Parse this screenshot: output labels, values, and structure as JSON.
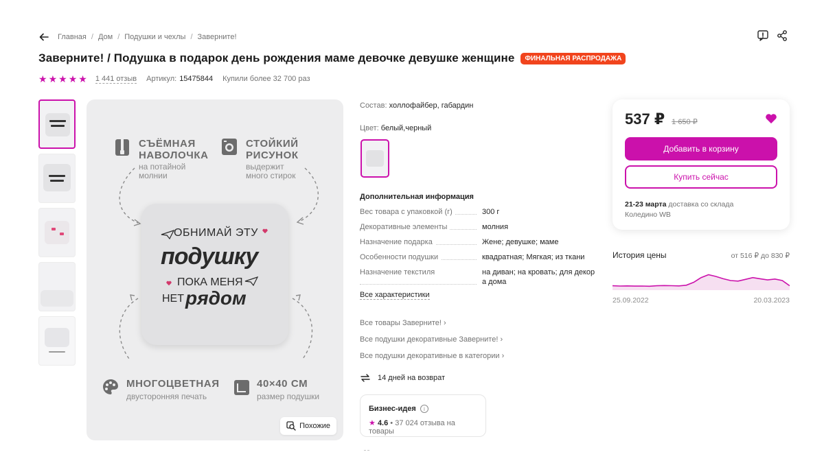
{
  "breadcrumbs": [
    "Главная",
    "Дом",
    "Подушки и чехлы",
    "Заверните!"
  ],
  "product": {
    "title": "Заверните! / Подушка в подарок день рождения маме девочке девушке женщине",
    "badge": "ФИНАЛЬНАЯ РАСПРОДАЖА",
    "rating_stars": 5,
    "reviews": "1 441 отзыв",
    "article_label": "Артикул:",
    "article": "15475844",
    "bought": "Купили более 32 700 раз"
  },
  "image": {
    "feature1_title": [
      "СЪЁМНАЯ",
      "НАВОЛОЧКА"
    ],
    "feature1_sub": [
      "на потайной",
      "молнии"
    ],
    "feature2_title": [
      "СТОЙКИЙ",
      "РИСУНОК"
    ],
    "feature2_sub": [
      "выдержит",
      "много стирок"
    ],
    "feature3_title": "МНОГОЦВЕТНАЯ",
    "feature3_sub": "двусторонняя печать",
    "feature4_title": "40×40 СМ",
    "feature4_sub": "размер подушки",
    "pillow_text": [
      "ОБНИМАЙ ЭТУ",
      "подушку",
      "ПОКА МЕНЯ",
      "НЕТ",
      "рядом"
    ],
    "similar_label": "Похожие"
  },
  "info": {
    "composition_label": "Состав:",
    "composition": "холлофайбер, габардин",
    "color_label": "Цвет:",
    "color": "белый,черный",
    "additional_title": "Дополнительная информация",
    "characteristics": [
      {
        "name": "Вес товара с упаковкой (г)",
        "value": "300 г"
      },
      {
        "name": "Декоративные элементы",
        "value": "молния"
      },
      {
        "name": "Назначение подарка",
        "value": "Жене; девушке; маме"
      },
      {
        "name": "Особенности подушки",
        "value": "квадратная; Мягкая; из ткани"
      },
      {
        "name": "Назначение текстиля",
        "value": "на диван; на кровать; для декор а дома"
      }
    ],
    "all_characteristics": "Все характеристики",
    "links": [
      "Все товары Заверните!",
      "Все подушки декоративные Заверните!",
      "Все подушки декоративные в категории"
    ],
    "return_text": "14 дней на возврат",
    "business_title": "Бизнес-идея",
    "business_rating": "4.6",
    "business_reviews": "37 024 отзыва на товары"
  },
  "price_card": {
    "price": "537 ₽",
    "old_price": "1 650 ₽",
    "add_to_cart": "Добавить в корзину",
    "buy_now": "Купить сейчас",
    "delivery_date": "21-23 марта",
    "delivery_text": "доставка со склада",
    "warehouse": "Коледино WB"
  },
  "price_history": {
    "title": "История цены",
    "range_text": "от 516 ₽ до 830 ₽",
    "start_date": "25.09.2022",
    "end_date": "20.03.2023",
    "values": [
      530,
      528,
      529,
      527,
      528,
      526,
      530,
      532,
      531,
      529,
      535,
      560,
      600,
      625,
      610,
      590,
      575,
      570,
      585,
      600,
      590,
      580,
      588,
      575,
      530
    ],
    "y_range": [
      516,
      830
    ]
  },
  "colors": {
    "accent": "#cb11ab",
    "sale": "#f1441d"
  }
}
